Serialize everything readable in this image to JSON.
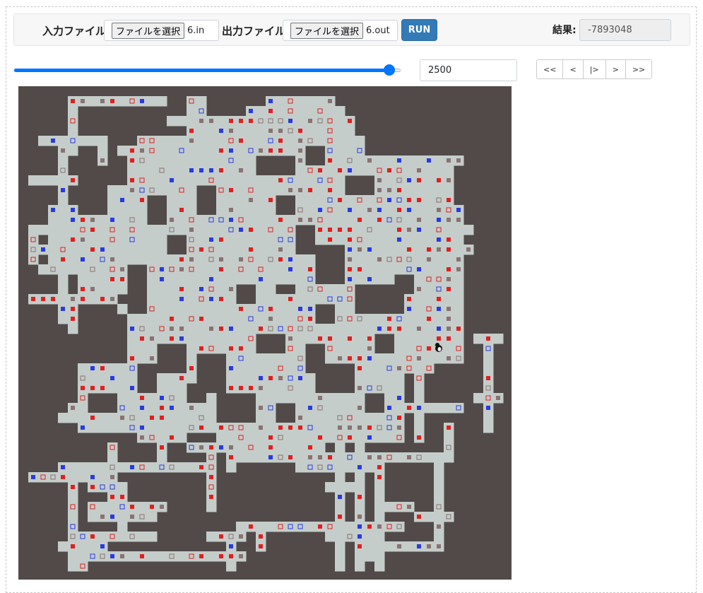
{
  "controls": {
    "input_label": "入力ファイル",
    "input_button": "ファイルを選択",
    "input_file": "6.in",
    "output_label": "出力ファイル",
    "output_button": "ファイルを選択",
    "output_file": "6.out",
    "run_label": "RUN",
    "result_label": "結果:",
    "result_value": "-7893048"
  },
  "playback": {
    "turn": "2500",
    "turn_fraction": 0.97,
    "buttons": [
      "<<",
      "<",
      "|>",
      ">",
      ">>"
    ]
  },
  "colors": {
    "board_background": "#514a48",
    "floor": "#c4cdca",
    "item_red": "#e02020",
    "item_blue": "#2a3ae0",
    "item_gray": "#8a7272",
    "accent": "#337ab7",
    "slider": "#0075ff"
  },
  "board": {
    "player_icon": "penguin-icon"
  }
}
